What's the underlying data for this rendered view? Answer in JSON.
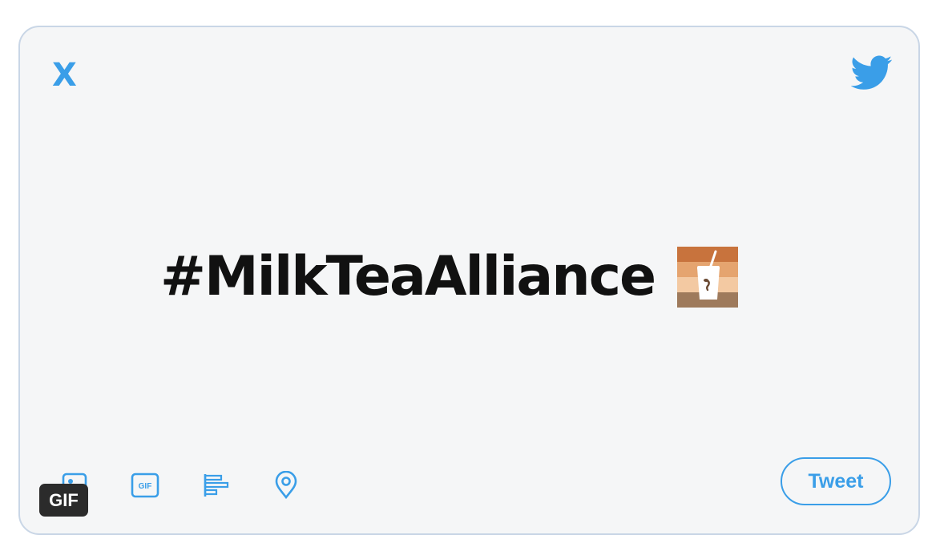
{
  "card": {
    "close_label": "X",
    "headline": "#MilkTeaAlliance",
    "emoji": "milk-tea-emoji",
    "tweet_label": "Tweet"
  },
  "toolbar": {
    "icons": [
      "image-icon",
      "gif-icon",
      "poll-icon",
      "location-icon"
    ],
    "gif_icon_text": "GIF"
  },
  "overlay": {
    "badge": "GIF"
  },
  "colors": {
    "accent": "#3a9ee8",
    "card_bg": "#f5f6f7",
    "card_border": "#c9d6e6",
    "headline": "#111111",
    "badge_bg": "#2b2b2b"
  }
}
